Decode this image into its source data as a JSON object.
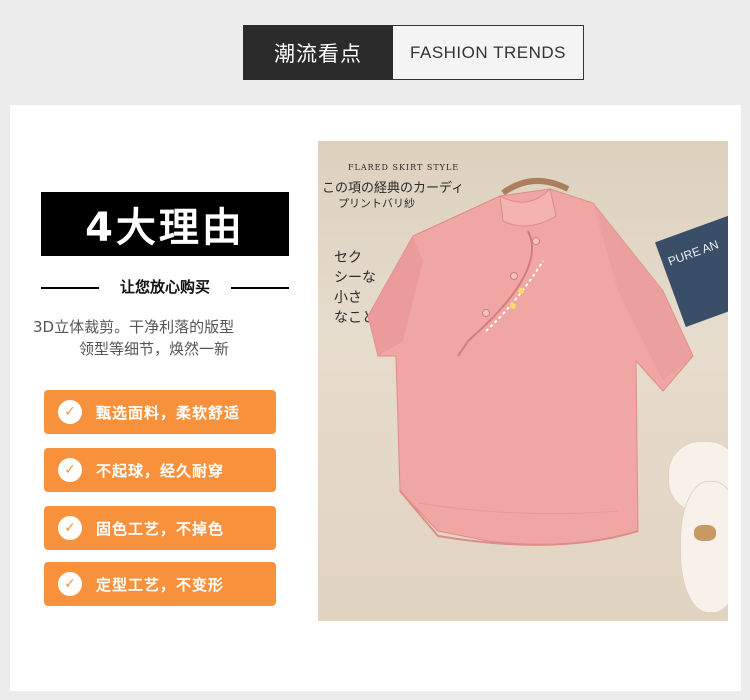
{
  "header": {
    "title_cn": "潮流看点",
    "title_en": "FASHION TRENDS"
  },
  "reasons": {
    "title": "4大理由",
    "subtitle": "让您放心购买",
    "description_line1": "3D立体裁剪。干净利落的版型",
    "description_line2": "领型等细节，焕然一新"
  },
  "features": [
    {
      "icon": "check-leaf-icon",
      "label": "甄选面料，柔软舒适"
    },
    {
      "icon": "check-leaf-icon",
      "label": "不起球，经久耐穿"
    },
    {
      "icon": "check-leaf-icon",
      "label": "固色工艺，不掉色"
    },
    {
      "icon": "check-leaf-icon",
      "label": "定型工艺，不变形"
    }
  ],
  "photo": {
    "magazine_top": "FLARED SKIRT STYLE",
    "magazine_title": "この項の経典のカーディ",
    "magazine_sub": "プリントバリ紗",
    "magazine_col1": "セク",
    "magazine_col2": "シーな",
    "magazine_col3": "小さ",
    "magazine_col4": "なこと",
    "book_text": "PURE AN",
    "colors": {
      "shirt": "#f0a6a2",
      "shirt_shade": "#dd8c88",
      "background": "#e2d3c1"
    }
  }
}
